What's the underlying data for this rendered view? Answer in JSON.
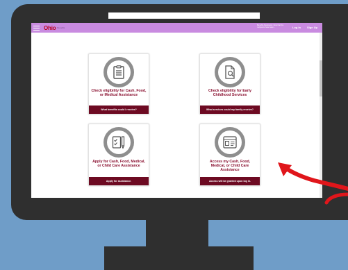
{
  "app": {
    "logo": "Ohio",
    "logo_sub": "Benefits",
    "notice": "Benefits Recipients: Now that the recipients have been...",
    "login": "Log In",
    "signup": "Sign Up"
  },
  "cards": [
    {
      "title": "Check eligibility for Cash, Food, or Medical Assistance",
      "footer": "What benefits could I receive?",
      "icon": "clipboard-list-icon"
    },
    {
      "title": "Check eligibility for Early Childhood Services",
      "footer": "What services could my family receive?",
      "icon": "document-search-icon"
    },
    {
      "title": "Apply for Cash, Food, Medical, or Child Care Assistance",
      "footer": "Apply for assistance.",
      "icon": "form-pencil-icon"
    },
    {
      "title": "Access my Cash, Food, Medical, or Child Care Assistance",
      "footer": "Access will be granted upon log in.",
      "icon": "id-card-icon"
    }
  ],
  "colors": {
    "background": "#6f9dc8",
    "monitor": "#2f2f2f",
    "topbar": "#c98be0",
    "card_footer": "#6d0a22",
    "card_title": "#8a1030",
    "arrow": "#e0161b"
  }
}
